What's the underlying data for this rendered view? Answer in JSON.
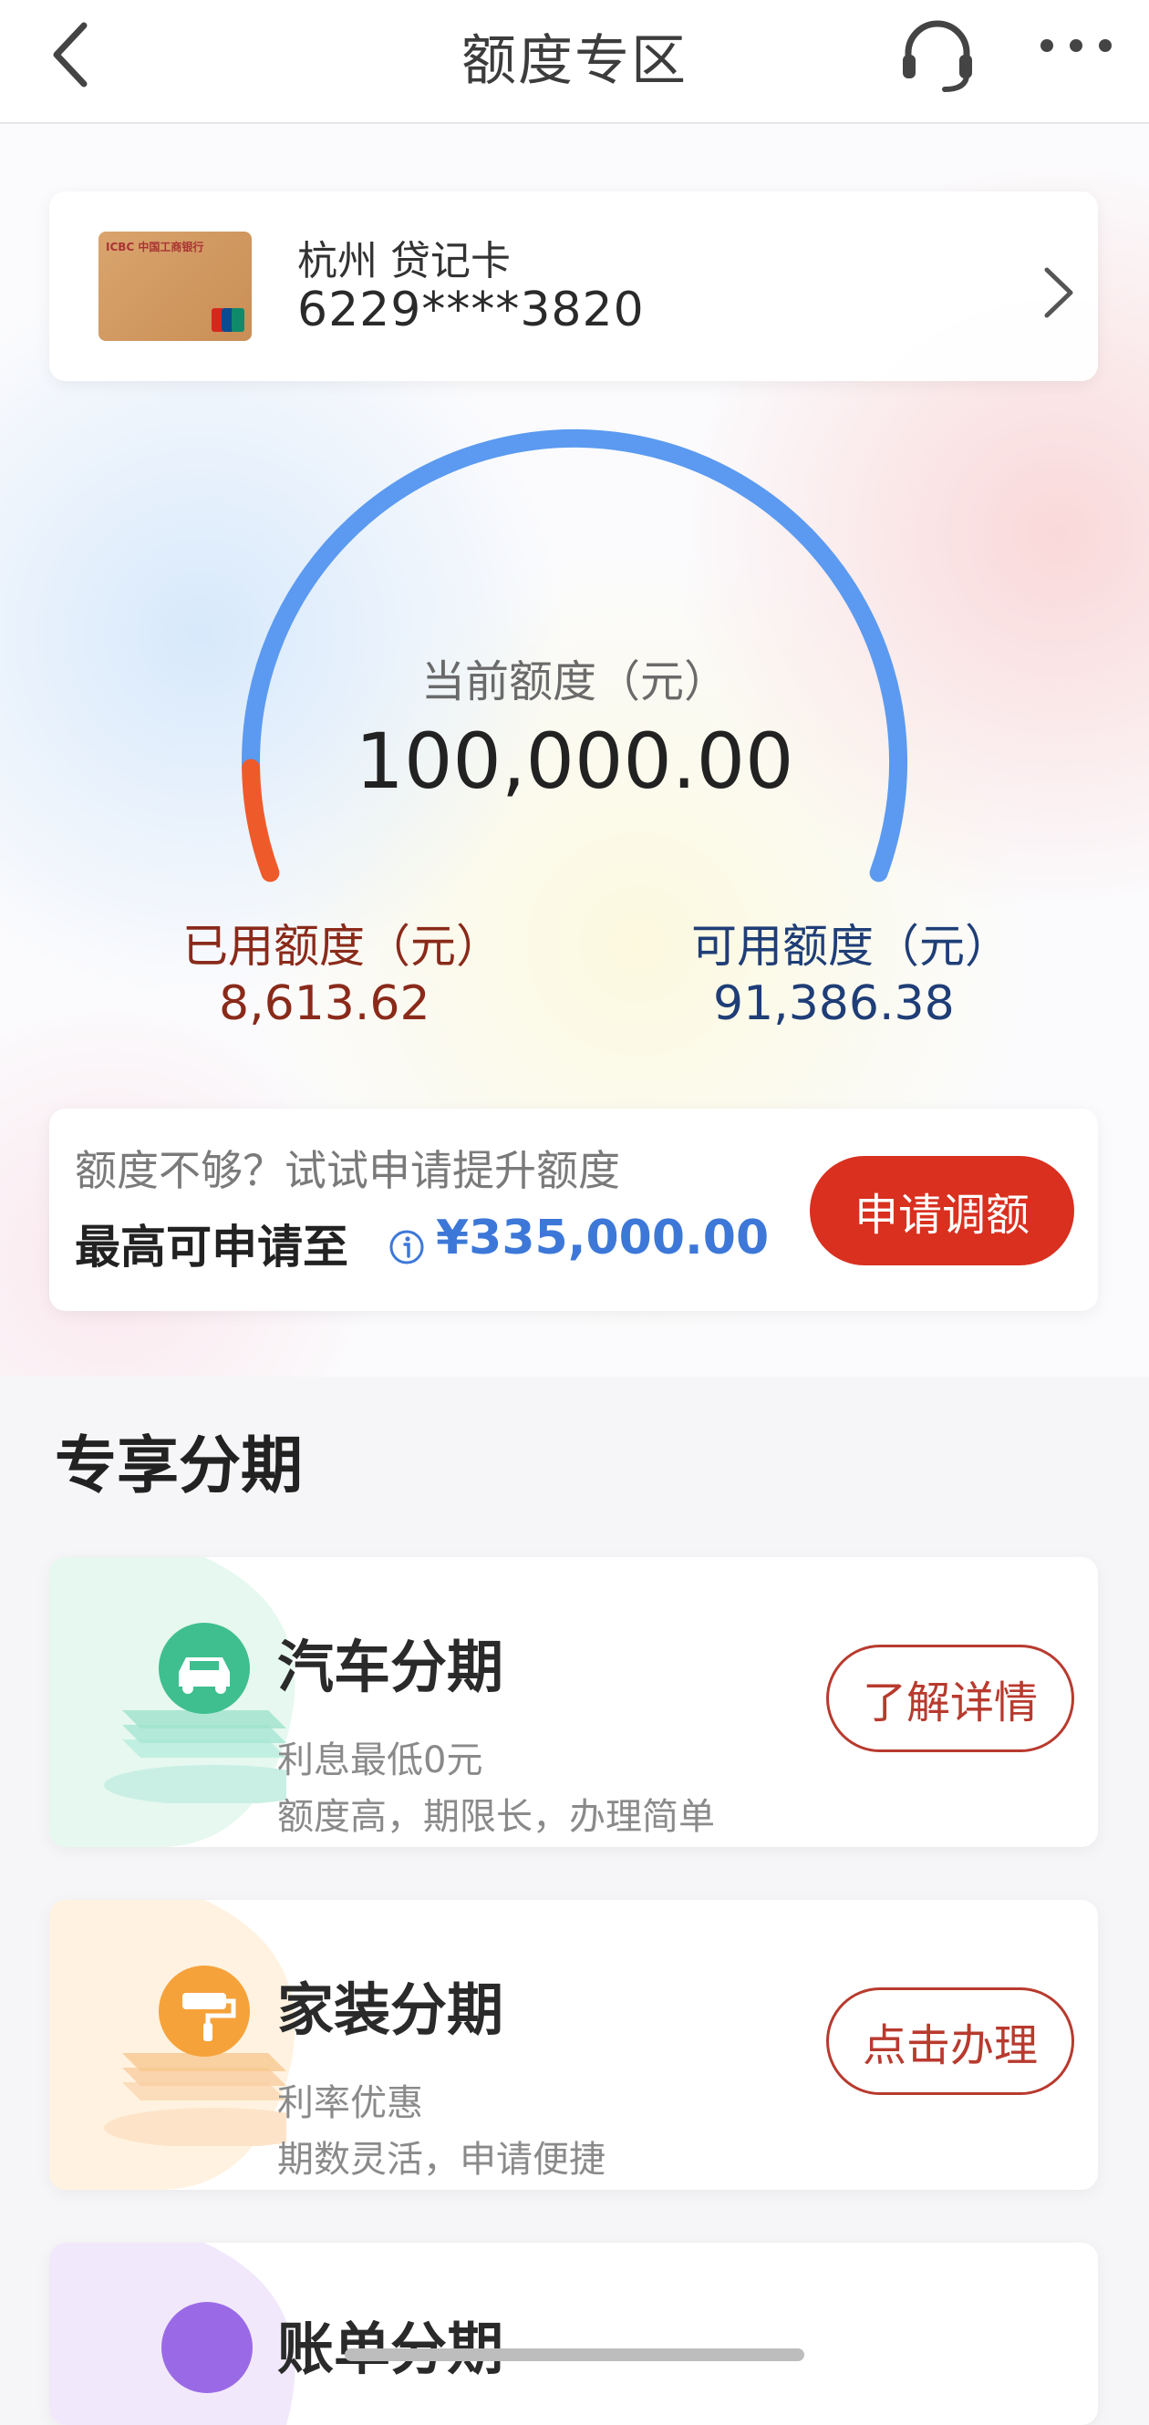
{
  "header": {
    "title": "额度专区",
    "icons": [
      "back-arrow-icon",
      "customer-service-headset-icon",
      "more-dots-icon"
    ]
  },
  "card": {
    "bank_text": "ICBC 中国工商银行",
    "name": "杭州 贷记卡",
    "number": "6229****3820"
  },
  "limit": {
    "current_label": "当前额度（元）",
    "current_value": "100,000.00",
    "used_label": "已用额度（元）",
    "used_value": "8,613.62",
    "available_label": "可用额度（元）",
    "available_value": "91,386.38",
    "used_fraction": 0.0861
  },
  "raise": {
    "hint": "额度不够？试试申请提升额度",
    "max_label": "最高可申请至",
    "max_value": "¥335,000.00",
    "button": "申请调额"
  },
  "section": {
    "title": "专享分期",
    "items": [
      {
        "title": "汽车分期",
        "line1": "利息最低0元",
        "line2": "额度高，期限长，办理简单",
        "button": "了解详情",
        "icon": "car-icon"
      },
      {
        "title": "家装分期",
        "line1": "利率优惠",
        "line2": "期数灵活，申请便捷",
        "button": "点击办理",
        "icon": "paint-roller-icon"
      },
      {
        "title": "账单分期",
        "icon": "bill-icon"
      }
    ]
  },
  "colors": {
    "accent_red": "#d9301f",
    "gauge_blue": "#5b9af0",
    "gauge_orange": "#ef5a2b",
    "used_text": "#8a2a1a",
    "available_text": "#1f3e77"
  }
}
